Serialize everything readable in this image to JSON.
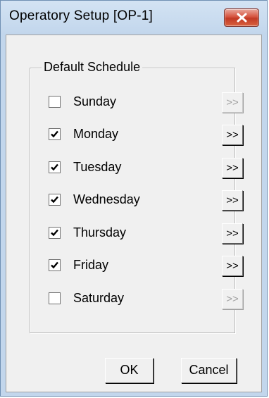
{
  "window": {
    "title": "Operatory Setup [OP-1]",
    "close_icon": "close-x-icon"
  },
  "schedule": {
    "group_label": "Default Schedule",
    "days": [
      {
        "label": "Sunday",
        "checked": false,
        "more_label": ">>",
        "more_enabled": false
      },
      {
        "label": "Monday",
        "checked": true,
        "more_label": ">>",
        "more_enabled": true
      },
      {
        "label": "Tuesday",
        "checked": true,
        "more_label": ">>",
        "more_enabled": true
      },
      {
        "label": "Wednesday",
        "checked": true,
        "more_label": ">>",
        "more_enabled": true
      },
      {
        "label": "Thursday",
        "checked": true,
        "more_label": ">>",
        "more_enabled": true
      },
      {
        "label": "Friday",
        "checked": true,
        "more_label": ">>",
        "more_enabled": true
      },
      {
        "label": "Saturday",
        "checked": false,
        "more_label": ">>",
        "more_enabled": false
      }
    ]
  },
  "buttons": {
    "ok_label": "OK",
    "cancel_label": "Cancel"
  },
  "colors": {
    "title_bar": "#c2d6ec",
    "client_bg": "#f0f0f0",
    "close_button": "#c23a25"
  }
}
